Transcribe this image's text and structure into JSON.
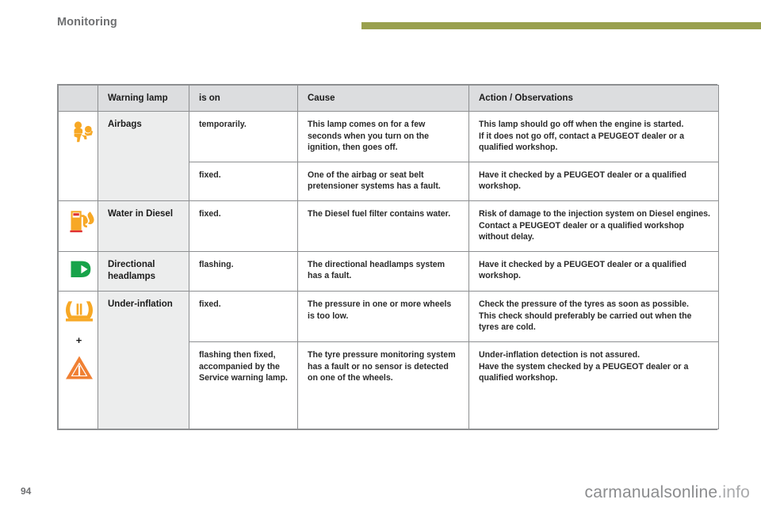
{
  "header": {
    "title": "Monitoring",
    "rule_color": "#99a04e"
  },
  "table": {
    "columns": [
      {
        "key": "icon",
        "label": ""
      },
      {
        "key": "lamp",
        "label": "Warning lamp"
      },
      {
        "key": "ison",
        "label": "is on"
      },
      {
        "key": "cause",
        "label": "Cause"
      },
      {
        "key": "action",
        "label": "Action / Observations"
      }
    ],
    "rows": [
      {
        "icon": "airbag-warning-icon",
        "icon_color": "#F7A825",
        "lamp": "Airbags",
        "ison": "temporarily.",
        "cause": "This lamp comes on for a few seconds when you turn on the ignition, then goes off.",
        "action": "This lamp should go off when the engine is started.\nIf it does not go off, contact a PEUGEOT dealer or a qualified workshop."
      },
      {
        "icon": "",
        "lamp": "",
        "ison": "fixed.",
        "cause": "One of the airbag or seat belt pretensioner systems has a fault.",
        "action": "Have it checked by a PEUGEOT dealer or a qualified workshop."
      },
      {
        "icon": "water-in-diesel-icon",
        "icon_color": "#F7A825",
        "lamp": "Water in Diesel",
        "ison": "fixed.",
        "cause": "The Diesel fuel filter contains water.",
        "action": "Risk of damage to the injection system on Diesel engines.\nContact a PEUGEOT dealer or a qualified workshop without delay."
      },
      {
        "icon": "directional-headlamps-icon",
        "icon_color": "#17A34A",
        "lamp": "Directional headlamps",
        "ison": "flashing.",
        "cause": "The directional headlamps system has a fault.",
        "action": "Have it checked by a PEUGEOT dealer or a qualified workshop."
      },
      {
        "icon": "tyre-under-inflation-icon",
        "icon_color": "#F7A825",
        "lamp": "Under-inflation",
        "ison": "fixed.",
        "cause": "The pressure in one or more wheels is too low.",
        "action": "Check the pressure of the tyres as soon as possible.\nThis check should preferably be carried out when the tyres are cold."
      },
      {
        "icon": "service-warning-triangle-icon",
        "icon_color": "#F08033",
        "plus": "+",
        "lamp": "",
        "ison": "flashing then fixed, accompanied by the Service warning lamp.",
        "cause": "The tyre pressure monitoring system has a fault or no sensor is detected on one of the wheels.",
        "action": "Under-inflation detection is not assured.\nHave the system checked by a PEUGEOT dealer or a qualified workshop."
      }
    ]
  },
  "footer": {
    "page_number": "94",
    "watermark_main": "carmanualsonline",
    "watermark_suffix": ".info"
  }
}
